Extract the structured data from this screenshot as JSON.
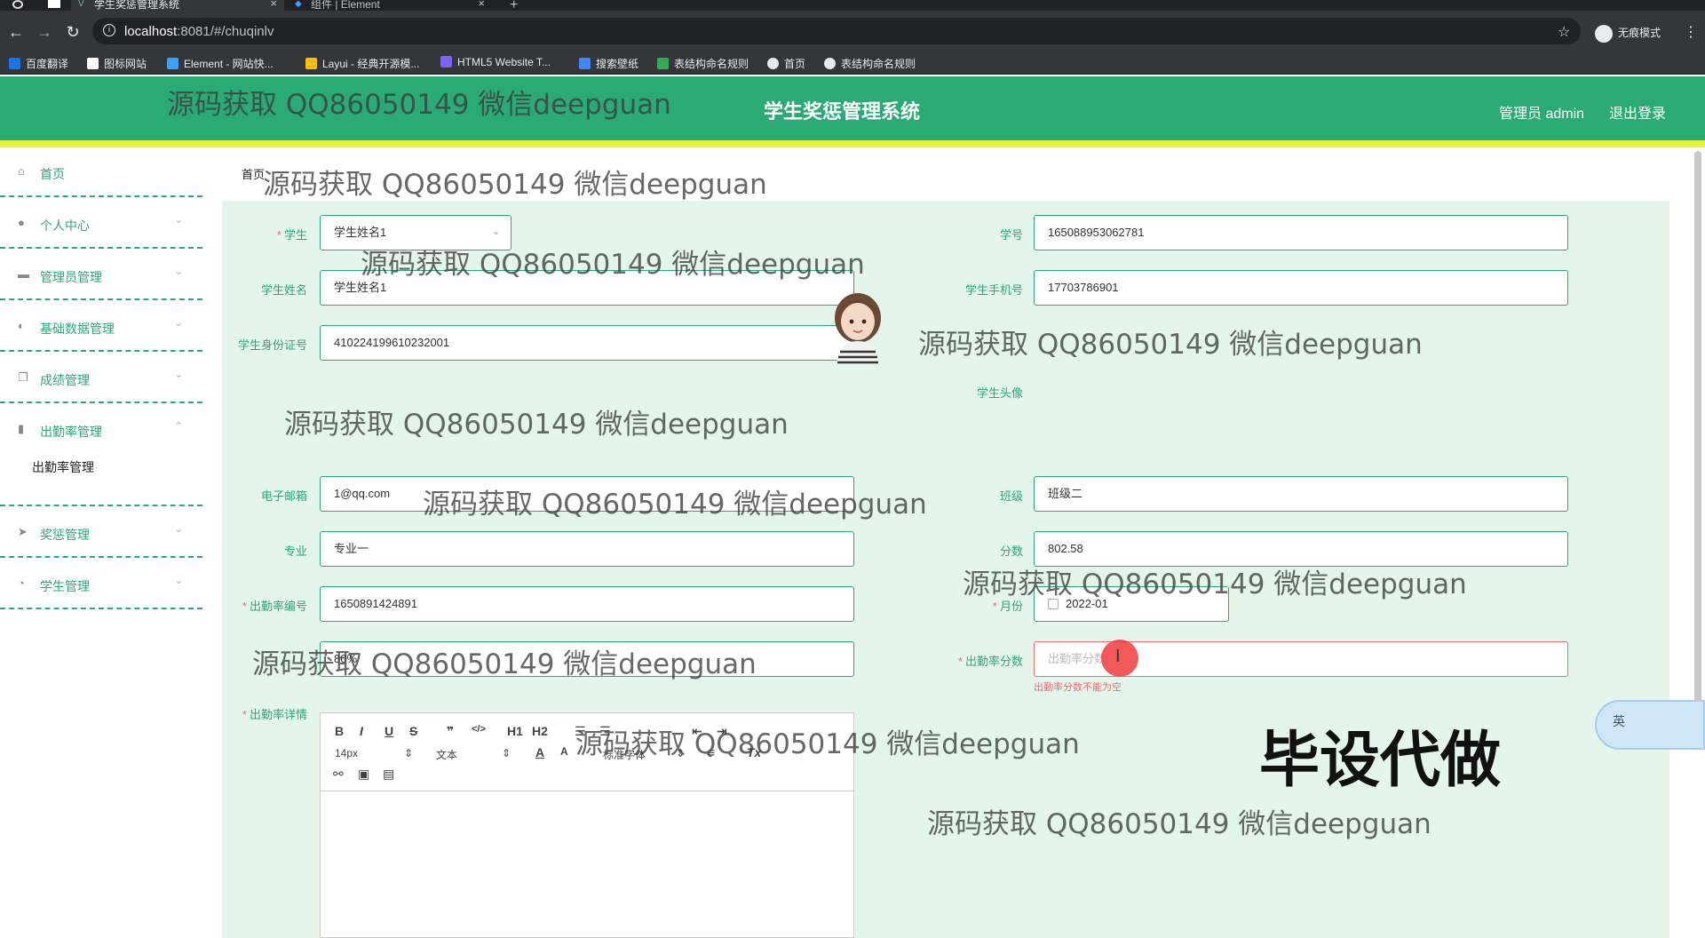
{
  "browser": {
    "tabs": [
      {
        "title": "学生奖惩管理系统",
        "active": true
      },
      {
        "title": "组件 | Element",
        "active": false
      }
    ],
    "url_host": "localhost",
    "url_path": ":8081/#/chuqinlv",
    "incognito_label": "无痕模式",
    "bookmarks": [
      {
        "label": "百度翻译",
        "icon_color": "#1a73e8"
      },
      {
        "label": "图标网站",
        "icon_color": "#ffffff"
      },
      {
        "label": "Element - 网站快...",
        "icon_color": "#409eff"
      },
      {
        "label": "Layui - 经典开源模...",
        "icon_color": "#fbbc04"
      },
      {
        "label": "HTML5 Website T...",
        "icon_color": "#7b61ff"
      },
      {
        "label": "搜索壁纸",
        "icon_color": "#4285f4"
      },
      {
        "label": "表结构命名规则",
        "icon_color": "#34a853"
      },
      {
        "label": "首页",
        "icon_color": "#e8eaed"
      },
      {
        "label": "表结构命名规则",
        "icon_color": "#e8eaed"
      }
    ]
  },
  "header": {
    "title": "学生奖惩管理系统",
    "admin": "管理员 admin",
    "logout": "退出登录",
    "color": "#2aaa75"
  },
  "sidebar": {
    "items": [
      {
        "label": "首页",
        "icon": "home-icon",
        "has_arrow": false
      },
      {
        "label": "个人中心",
        "icon": "user-icon",
        "has_arrow": true
      },
      {
        "label": "管理员管理",
        "icon": "chat-icon",
        "has_arrow": true
      },
      {
        "label": "基础数据管理",
        "icon": "mic-icon",
        "has_arrow": true
      },
      {
        "label": "成绩管理",
        "icon": "copy-icon",
        "has_arrow": true
      },
      {
        "label": "出勤率管理",
        "icon": "chart-icon",
        "has_arrow": true,
        "expanded": true
      },
      {
        "label": "奖惩管理",
        "icon": "send-icon",
        "has_arrow": true
      },
      {
        "label": "学生管理",
        "icon": "gauge-icon",
        "has_arrow": true
      }
    ],
    "sub_item": "出勤率管理"
  },
  "breadcrumb": {
    "home": "首页"
  },
  "form": {
    "student_label": "学生",
    "student_value": "学生姓名1",
    "student_no_label": "学号",
    "student_no_value": "165088953062781",
    "name_label": "学生姓名",
    "name_value": "学生姓名1",
    "phone_label": "学生手机号",
    "phone_value": "17703786901",
    "id_card_label": "学生身份证号",
    "id_card_value": "410224199610232001",
    "avatar_label": "学生头像",
    "email_label": "电子邮箱",
    "email_value": "1@qq.com",
    "class_label": "班级",
    "class_value": "班级二",
    "major_label": "专业",
    "major_value": "专业一",
    "score_label": "分数",
    "score_value": "802.58",
    "attendance_no_label": "出勤率编号",
    "attendance_no_value": "1650891424891",
    "month_label": "月份",
    "month_value": "2022-01",
    "hidden_field_value": "80%",
    "attendance_score_label": "出勤率分数",
    "attendance_score_placeholder": "出勤率分数",
    "attendance_score_error": "出勤率分数不能为空",
    "detail_label": "出勤率详情"
  },
  "editor": {
    "buttons": [
      "B",
      "I",
      "U",
      "S",
      "❞",
      "</>",
      "H1",
      "H2"
    ],
    "font_size": "14px",
    "block_type": "文本",
    "font_family": "标准字体"
  },
  "overlays": {
    "watermark": "源码获取 QQ86050149 微信deepguan",
    "promo": "毕设代做",
    "float_widget_label": "英"
  }
}
